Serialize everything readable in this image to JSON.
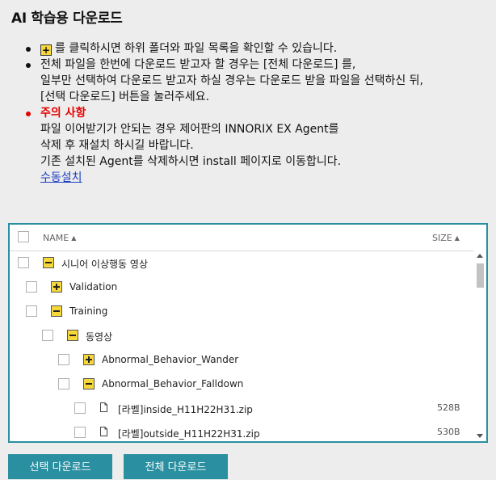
{
  "title": "AI 학습용 다운로드",
  "notes": {
    "item1": "를 클릭하시면 하위 폴더와 파일 목록을 확인할 수 있습니다.",
    "item2_line1": "전체 파일을 한번에 다운로드 받고자 할 경우는 [전체 다운로드] 를,",
    "item2_line2": "일부만 선택하여 다운로드 받고자 하실 경우는 다운로드 받을 파일을 선택하신 뒤,",
    "item2_line3": "[선택 다운로드] 버튼을 눌러주세요.",
    "warn_title": "주의 사항",
    "warn_line1": "파일 이어받기가 안되는 경우 제어판의 INNORIX EX Agent를",
    "warn_line2": "삭제 후 재설치 하시길 바랍니다.",
    "warn_line3": "기존 설치된 Agent를 삭제하시면 install 페이지로 이동합니다.",
    "manual_install_link": "수동설치"
  },
  "tree": {
    "header": {
      "name": "NAME",
      "size": "SIZE"
    },
    "rows": [
      {
        "label": "시니어 이상행동 영상",
        "toggle": "minus",
        "size": ""
      },
      {
        "label": "Validation",
        "toggle": "plus",
        "size": ""
      },
      {
        "label": "Training",
        "toggle": "minus",
        "size": ""
      },
      {
        "label": "동영상",
        "toggle": "minus",
        "size": ""
      },
      {
        "label": "Abnormal_Behavior_Wander",
        "toggle": "plus",
        "size": ""
      },
      {
        "label": "Abnormal_Behavior_Falldown",
        "toggle": "minus",
        "size": ""
      },
      {
        "label": "[라벨]inside_H11H22H31.zip",
        "toggle": "file",
        "size": "528B"
      },
      {
        "label": "[라벨]outside_H11H22H31.zip",
        "toggle": "file",
        "size": "530B"
      }
    ]
  },
  "buttons": {
    "selected_download": "선택 다운로드",
    "all_download": "전체 다운로드"
  },
  "colors": {
    "accent": "#2a8fa0",
    "warning": "#e60000",
    "link": "#1a3dc1",
    "toggle_fill": "#f7d83a"
  }
}
